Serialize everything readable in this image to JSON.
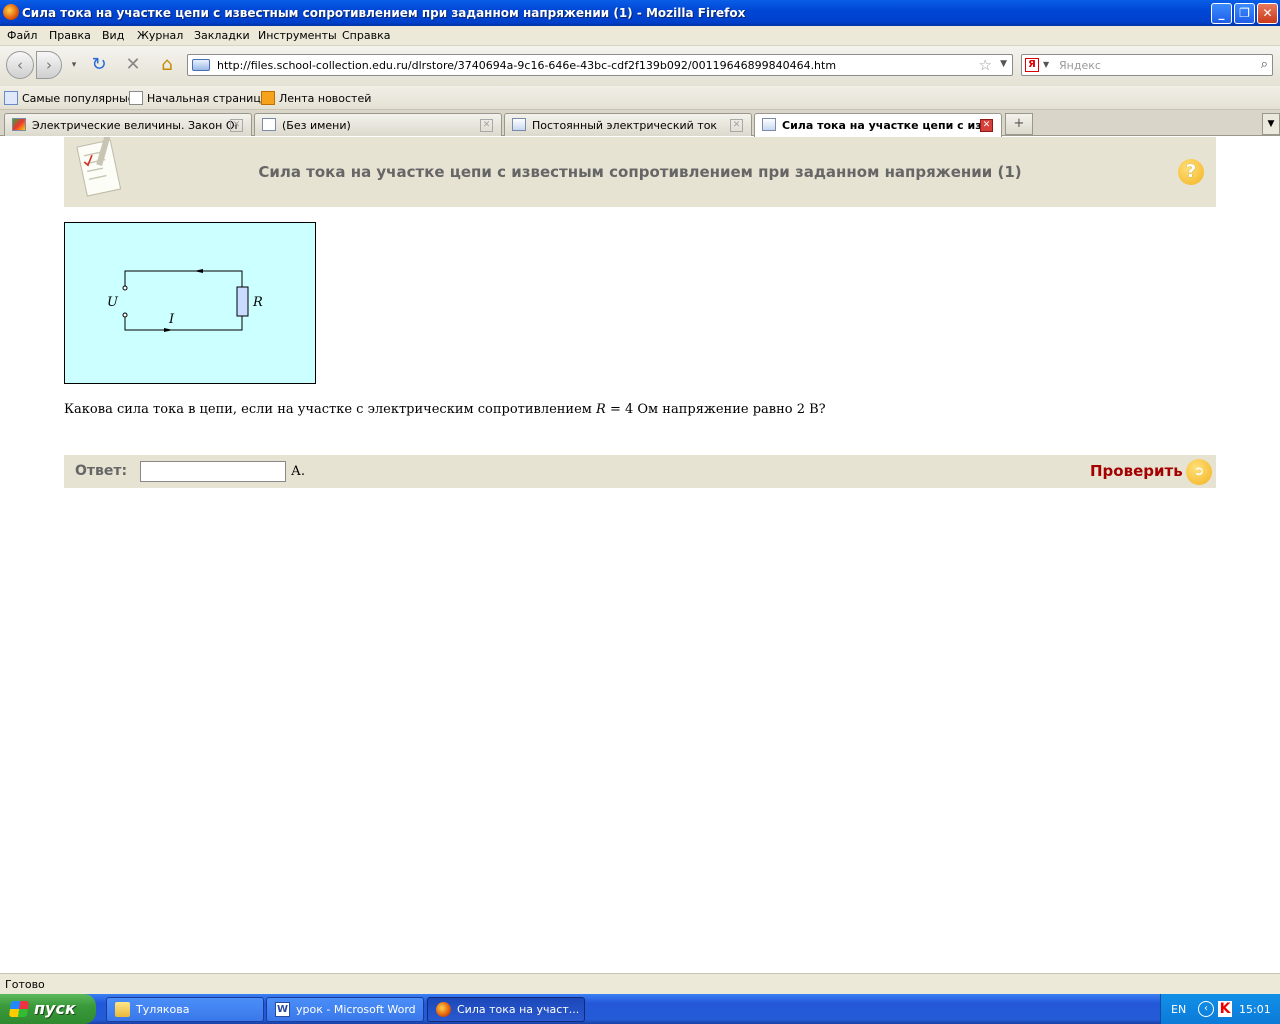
{
  "window": {
    "title": "Сила тока на участке цепи с известным сопротивлением при заданном напряжении (1) - Mozilla Firefox"
  },
  "menu": [
    "Файл",
    "Правка",
    "Вид",
    "Журнал",
    "Закладки",
    "Инструменты",
    "Справка"
  ],
  "nav": {
    "url": "http://files.school-collection.edu.ru/dlrstore/3740694a-9c16-646e-43bc-cdf2f139b092/00119646899840464.htm",
    "search_placeholder": "Яндекс"
  },
  "bookmarks": [
    "Самые популярные",
    "Начальная страница",
    "Лента новостей"
  ],
  "tabs": [
    {
      "label": "Электрические величины. Закон Ома",
      "active": false
    },
    {
      "label": "(Без имени)",
      "active": false
    },
    {
      "label": "Постоянный электрический ток",
      "active": false
    },
    {
      "label": "Сила тока на участке цепи с из...",
      "active": true
    }
  ],
  "page": {
    "title": "Сила тока на участке цепи с известным сопротивлением при заданном напряжении (1)",
    "help": "?",
    "circuit": {
      "label_u": "U",
      "label_r": "R",
      "label_i": "I"
    },
    "question_start": "Какова сила тока в цепи, если на участке с электрическим сопротивлением ",
    "question_var": "R",
    "question_end": " = 4 Ом напряжение равно 2 В?",
    "answer_label": "Ответ:",
    "answer_value": "",
    "unit": "А.",
    "check_label": "Проверить"
  },
  "status": {
    "text": "Готово"
  },
  "taskbar": {
    "start_label": "пуск",
    "tasks": [
      {
        "label": "Тулякова",
        "active": false
      },
      {
        "label": "урок - Microsoft Word",
        "active": false
      },
      {
        "label": "Сила тока на участ...",
        "active": true
      }
    ],
    "lang": "EN",
    "clock": "15:01"
  }
}
